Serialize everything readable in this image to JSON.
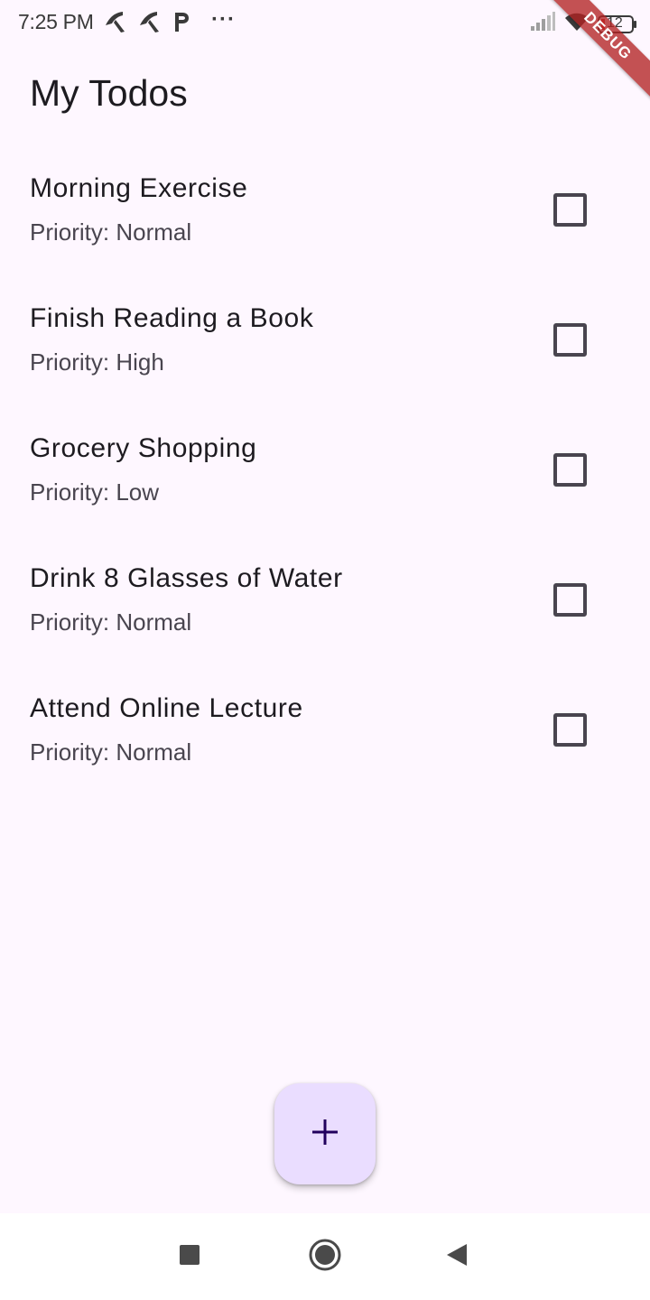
{
  "status_bar": {
    "time": "7:25 PM",
    "notification_icons": [
      "carrier-icon",
      "carrier-icon",
      "parking-icon"
    ],
    "more_indicator": "···",
    "battery_level": "12",
    "signal_icon": "cell-signal-icon",
    "wifi_icon": "wifi-icon"
  },
  "debug_banner": "DEBUG",
  "app_bar": {
    "title": "My Todos"
  },
  "todos": [
    {
      "title": "Morning Exercise",
      "priority": "Priority: Normal",
      "checked": false
    },
    {
      "title": "Finish Reading a Book",
      "priority": "Priority: High",
      "checked": false
    },
    {
      "title": "Grocery Shopping",
      "priority": "Priority: Low",
      "checked": false
    },
    {
      "title": "Drink 8 Glasses of Water",
      "priority": "Priority: Normal",
      "checked": false
    },
    {
      "title": "Attend Online Lecture",
      "priority": "Priority: Normal",
      "checked": false
    }
  ],
  "fab": {
    "icon": "plus-icon"
  },
  "nav_bar": {
    "buttons": [
      "recents-square-icon",
      "home-circle-icon",
      "back-triangle-icon"
    ]
  },
  "colors": {
    "background": "#FEF7FF",
    "fab_background": "#EADDFF",
    "fab_icon": "#21005D",
    "text_primary": "#1D1B20",
    "text_secondary": "#49454F",
    "debug_ribbon": "#B22222"
  }
}
